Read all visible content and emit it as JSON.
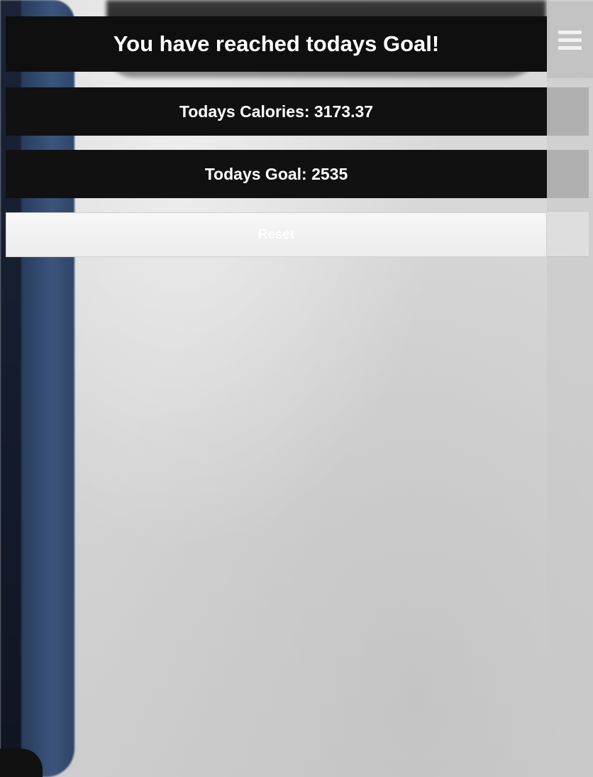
{
  "header": {
    "goal_message": "You have reached todays Goal!"
  },
  "stats": {
    "calories_label": "Todays Calories: 3173.37",
    "goal_label": "Todays Goal: 2535"
  },
  "actions": {
    "reset_label": "Reset"
  },
  "menu": {
    "icon": "hamburger-menu-icon"
  },
  "colors": {
    "panel_background": "#111111",
    "panel_text": "#ffffff",
    "reset_background": "#f0f0f0",
    "menu_icon": "#f2f2f2"
  }
}
